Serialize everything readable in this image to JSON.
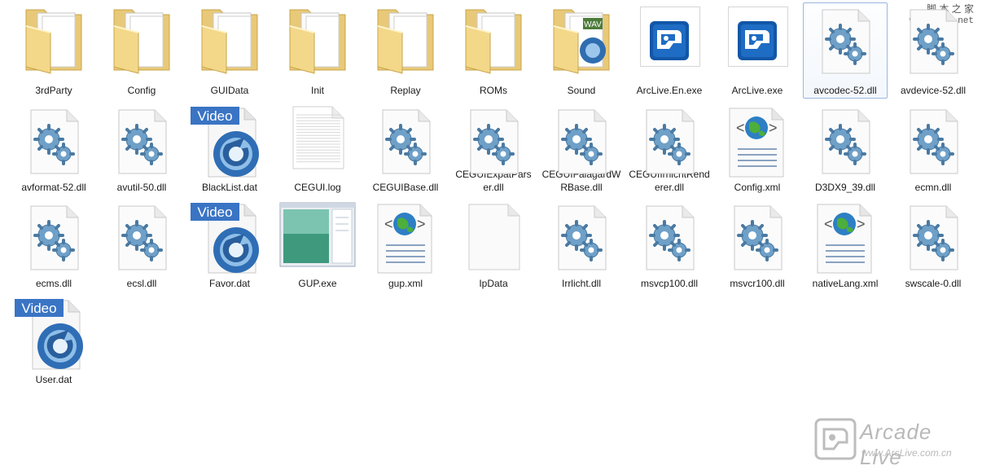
{
  "corner": {
    "line1": "脚 本 之 家",
    "line2": "www.Jb51.net"
  },
  "watermark": {
    "title": "Arcade Live",
    "url": "www.ArcLive.com.cn"
  },
  "files": [
    {
      "label": "3rdParty",
      "icon": "folder-icon"
    },
    {
      "label": "Config",
      "icon": "folder-icon"
    },
    {
      "label": "GUIData",
      "icon": "folder-icon"
    },
    {
      "label": "Init",
      "icon": "folder-icon"
    },
    {
      "label": "Replay",
      "icon": "folder-icon"
    },
    {
      "label": "ROMs",
      "icon": "folder-icon"
    },
    {
      "label": "Sound",
      "icon": "folder-icon",
      "badge": "WAV"
    },
    {
      "label": "ArcLive.En.exe",
      "icon": "arclive-app-icon"
    },
    {
      "label": "ArcLive.exe",
      "icon": "arclive-app-icon"
    },
    {
      "label": "avcodec-52.dll",
      "icon": "dll-icon",
      "selected": true
    },
    {
      "label": "avdevice-52.dll",
      "icon": "dll-icon"
    },
    {
      "label": "avformat-52.dll",
      "icon": "dll-icon"
    },
    {
      "label": "avutil-50.dll",
      "icon": "dll-icon"
    },
    {
      "label": "BlackList.dat",
      "icon": "video-file-icon",
      "badge": "Video"
    },
    {
      "label": "CEGUI.log",
      "icon": "text-file-icon"
    },
    {
      "label": "CEGUIBase.dll",
      "icon": "dll-icon"
    },
    {
      "label": "CEGUIExpatParser.dll",
      "icon": "dll-icon"
    },
    {
      "label": "CEGUIFalagardWRBase.dll",
      "icon": "dll-icon"
    },
    {
      "label": "CEGUIIrrlichtRenderer.dll",
      "icon": "dll-icon"
    },
    {
      "label": "Config.xml",
      "icon": "xml-file-icon"
    },
    {
      "label": "D3DX9_39.dll",
      "icon": "dll-icon"
    },
    {
      "label": "ecmn.dll",
      "icon": "dll-icon"
    },
    {
      "label": "ecms.dll",
      "icon": "dll-icon"
    },
    {
      "label": "ecsl.dll",
      "icon": "dll-icon"
    },
    {
      "label": "Favor.dat",
      "icon": "video-file-icon",
      "badge": "Video"
    },
    {
      "label": "GUP.exe",
      "icon": "app-window-icon"
    },
    {
      "label": "gup.xml",
      "icon": "xml-file-icon"
    },
    {
      "label": "IpData",
      "icon": "blank-file-icon"
    },
    {
      "label": "Irrlicht.dll",
      "icon": "dll-icon"
    },
    {
      "label": "msvcp100.dll",
      "icon": "dll-icon"
    },
    {
      "label": "msvcr100.dll",
      "icon": "dll-icon"
    },
    {
      "label": "nativeLang.xml",
      "icon": "xml-file-icon"
    },
    {
      "label": "swscale-0.dll",
      "icon": "dll-icon"
    },
    {
      "label": "User.dat",
      "icon": "video-file-icon",
      "badge": "Video"
    }
  ]
}
